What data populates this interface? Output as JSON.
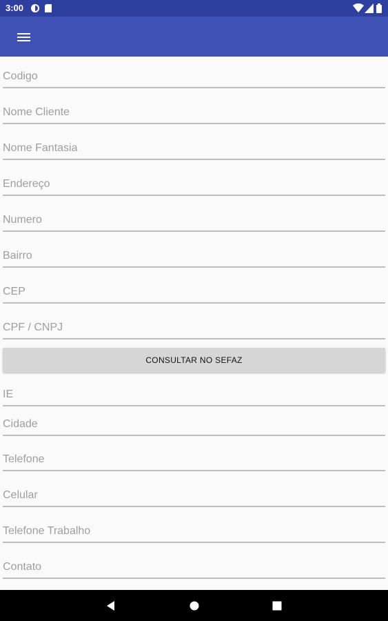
{
  "status_bar": {
    "time": "3:00",
    "icons": [
      "sync-icon",
      "sd-card-icon",
      "wifi-icon",
      "signal-icon",
      "battery-icon"
    ]
  },
  "app_bar": {
    "menu_icon": "hamburger-menu-icon",
    "color": "#3f51b5"
  },
  "form": {
    "codigo_placeholder": "Codigo",
    "nome_cliente_placeholder": "Nome Cliente",
    "nome_fantasia_placeholder": "Nome Fantasia",
    "endereco_placeholder": "Endereço",
    "numero_placeholder": "Numero",
    "bairro_placeholder": "Bairro",
    "cep_placeholder": "CEP",
    "cpf_cnpj_placeholder": "CPF / CNPJ",
    "consultar_label": "CONSULTAR NO SEFAZ",
    "ie_placeholder": "IE",
    "cidade_placeholder": "Cidade",
    "telefone_placeholder": "Telefone",
    "celular_placeholder": "Celular",
    "telefone_trabalho_placeholder": "Telefone Trabalho",
    "contato_placeholder": "Contato"
  },
  "nav_bar": {
    "icons": [
      "back-icon",
      "home-icon",
      "recents-icon"
    ]
  }
}
